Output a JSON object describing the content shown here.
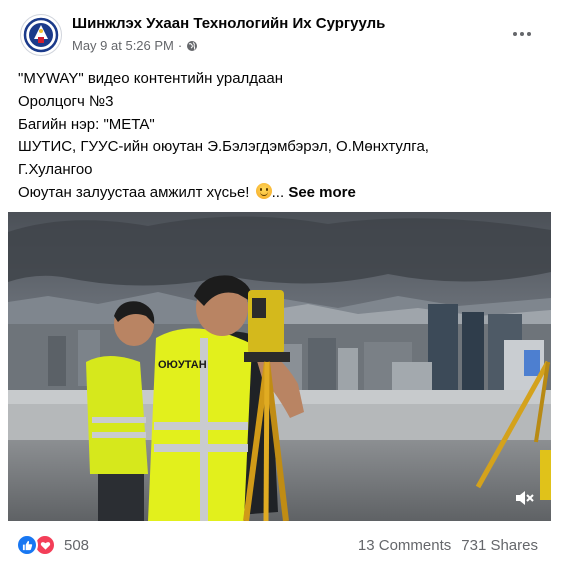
{
  "post": {
    "page_name": "Шинжлэх Ухаан Технологийн Их Сургууль",
    "timestamp": "May 9 at 5:26 PM",
    "separator": "·",
    "privacy_icon": "globe-icon",
    "more_icon": "more-options-icon",
    "text_lines": [
      "\"MYWAY\" видео контентийн уралдаан",
      "Оролцогч №3",
      "Багийн нэр: \"META\"",
      "ШУТИС, ГУУС-ийн оюутан Э.Бэлэгдэмбэрэл, О.Мөнхтулга,",
      "Г.Хулангоо",
      "Оюутан залуустаа амжилт хүсье!"
    ],
    "emoji": "smiling-face-emoji",
    "ellipsis": "...",
    "see_more": "See more"
  },
  "video": {
    "vest_text": "ОЮУТАН",
    "mute_icon": "speaker-muted-icon"
  },
  "footer": {
    "reaction_icons": [
      "like-icon",
      "love-icon"
    ],
    "reactions_count": "508",
    "comments": "13 Comments",
    "shares": "731 Shares"
  },
  "colors": {
    "link_blue": "#1877f2",
    "love_red": "#f33e58",
    "secondary_text": "#65676b",
    "vest_yellow": "#e8f01a"
  }
}
